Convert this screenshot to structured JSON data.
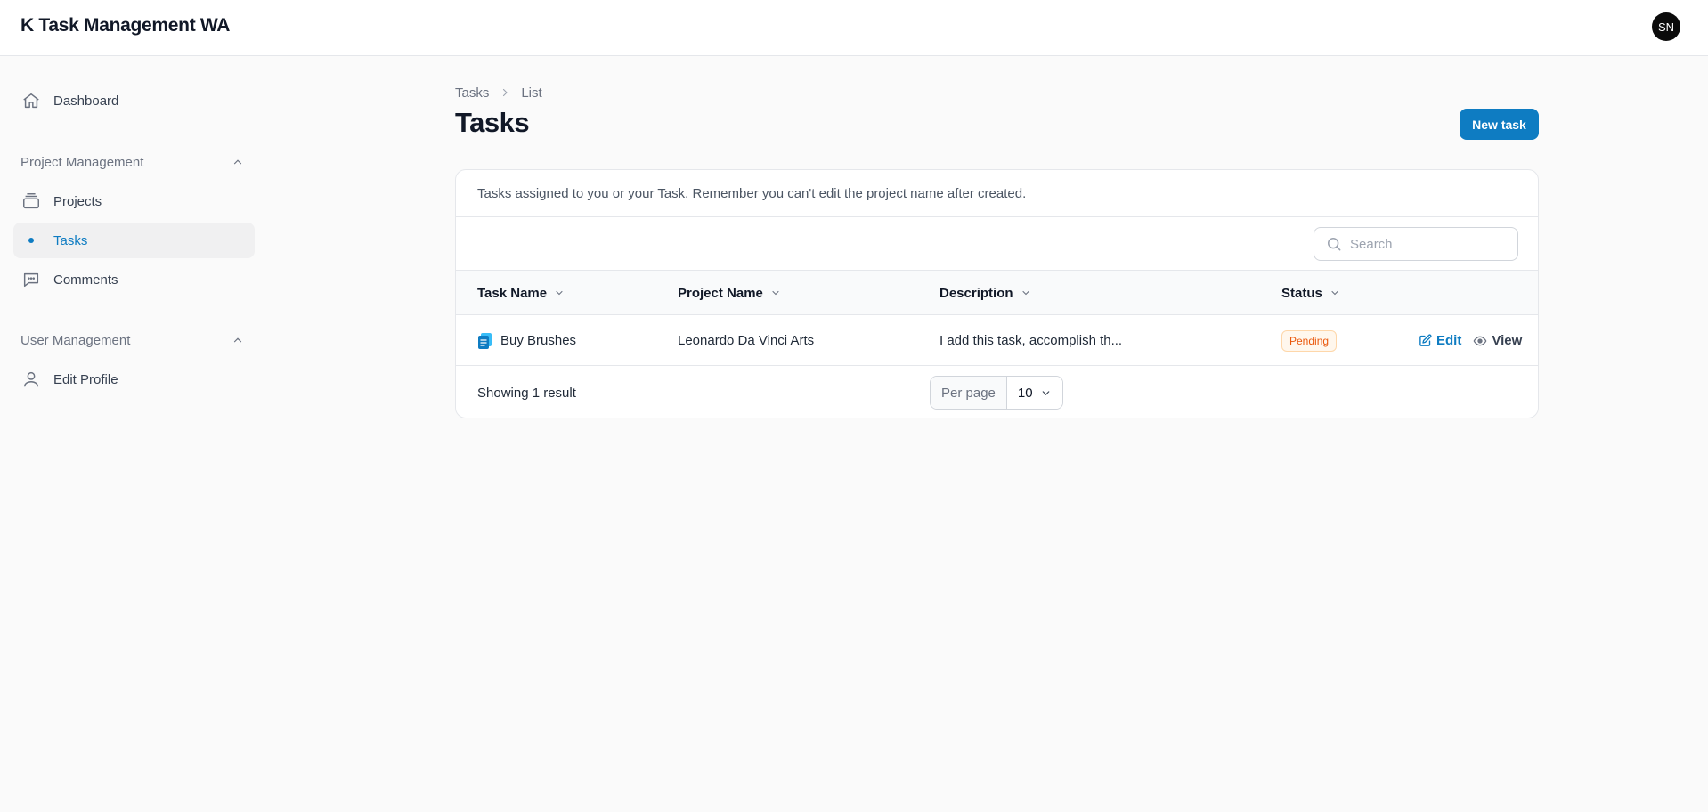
{
  "app": {
    "title": "K Task Management WA",
    "avatar_initials": "SN"
  },
  "sidebar": {
    "dashboard": "Dashboard",
    "groups": [
      {
        "label": "Project Management",
        "items": [
          "Projects",
          "Tasks",
          "Comments"
        ]
      },
      {
        "label": "User Management",
        "items": [
          "Edit Profile"
        ]
      }
    ],
    "active_item": "Tasks"
  },
  "breadcrumb": [
    "Tasks",
    "List"
  ],
  "page": {
    "title": "Tasks",
    "new_button": "New task"
  },
  "table": {
    "description": "Tasks assigned to you or your Task. Remember you can't edit the project name after created.",
    "search_placeholder": "Search",
    "columns": [
      "Task Name",
      "Project Name",
      "Description",
      "Status"
    ],
    "rows": [
      {
        "task_name": "Buy Brushes",
        "project_name": "Leonardo Da Vinci Arts",
        "description": "I add this task, accomplish th...",
        "status": "Pending",
        "edit_label": "Edit",
        "view_label": "View"
      }
    ],
    "footer": {
      "showing": "Showing 1 result",
      "per_page_label": "Per page",
      "per_page_value": "10"
    }
  },
  "colors": {
    "accent": "#0e7cc2",
    "pending": "#ea580c"
  }
}
